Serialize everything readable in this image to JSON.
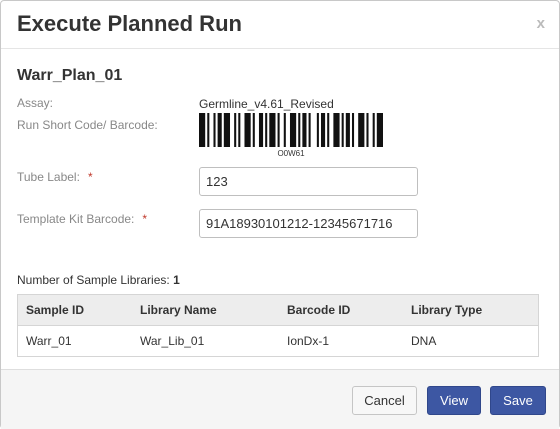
{
  "dialog": {
    "title": "Execute Planned Run",
    "close_label": "x"
  },
  "plan": {
    "name": "Warr_Plan_01",
    "assay_label": "Assay:",
    "assay_value": "Germline_v4.61_Revised",
    "run_code_label": "Run Short Code/ Barcode:",
    "barcode_caption": "O0W61"
  },
  "form": {
    "tube_label": "Tube Label:",
    "tube_value": "123",
    "kit_label": "Template Kit Barcode:",
    "kit_value": "91A18930101212-12345671716",
    "required_marker": "*"
  },
  "samples": {
    "count_label": "Number of Sample Libraries:",
    "count_value": "1",
    "columns": [
      "Sample ID",
      "Library Name",
      "Barcode ID",
      "Library Type"
    ],
    "rows": [
      [
        "Warr_01",
        "War_Lib_01",
        "IonDx-1",
        "DNA"
      ]
    ]
  },
  "footer": {
    "cancel_label": "Cancel",
    "view_label": "View",
    "save_label": "Save"
  },
  "colors": {
    "primary_button": "#3d57a3",
    "required_marker": "#c0392b"
  }
}
